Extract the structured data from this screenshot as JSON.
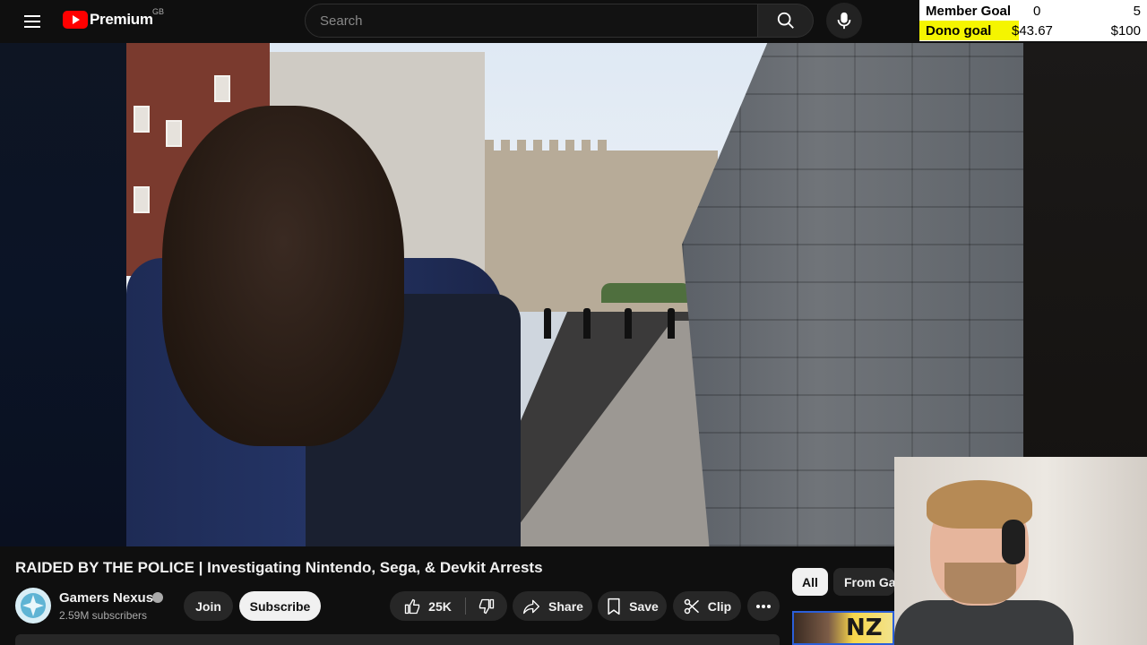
{
  "header": {
    "logo_text": "Premium",
    "region": "GB",
    "search_placeholder": "Search"
  },
  "goals": {
    "member_label": "Member Goal",
    "member_current": "0",
    "member_target": "5",
    "dono_label": "Dono goal",
    "dono_current": "$43.67",
    "dono_target": "$100",
    "dono_progress": 0.4367,
    "dono_fill_color": "#f5f500"
  },
  "video": {
    "title": "RAIDED BY THE POLICE | Investigating Nintendo, Sega, & Devkit Arrests"
  },
  "channel": {
    "name": "Gamers Nexus",
    "subscribers": "2.59M subscribers"
  },
  "actions": {
    "join": "Join",
    "subscribe": "Subscribe",
    "likes": "25K",
    "share": "Share",
    "save": "Save",
    "clip": "Clip"
  },
  "chips": {
    "all": "All",
    "from": "From Gamers Nexus"
  },
  "thumbnail": {
    "text": "NZ"
  },
  "icons": [
    "menu-icon",
    "youtube-logo-icon",
    "search-icon",
    "mic-icon",
    "verified-icon",
    "like-icon",
    "dislike-icon",
    "share-icon",
    "save-icon",
    "clip-icon",
    "more-icon"
  ]
}
